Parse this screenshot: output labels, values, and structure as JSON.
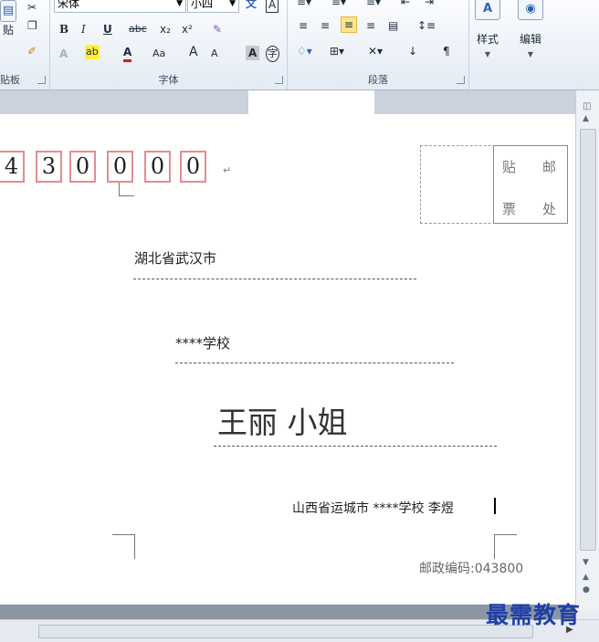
{
  "ribbon": {
    "clipboard": {
      "label": "贴板",
      "paste_label": "贴"
    },
    "font": {
      "label": "字体",
      "font_name": "宋体",
      "font_size": "小四",
      "bold": "B",
      "italic": "I",
      "underline": "U",
      "strike": "abc",
      "subscript": "x₂",
      "superscript": "x²",
      "text_effect": "A",
      "highlight": "ab",
      "font_color": "A",
      "change_case": "Aa",
      "grow_font": "A",
      "shrink_font": "A",
      "char_shading": "A",
      "enclose": "字"
    },
    "paragraph": {
      "label": "段落"
    },
    "styles": {
      "label": "样式"
    },
    "editing": {
      "label": "编辑"
    }
  },
  "document": {
    "postcode_digits": [
      "4",
      "3",
      "0",
      "0",
      "0",
      "0"
    ],
    "stamp": {
      "tl": "贴",
      "tr": "邮",
      "bl": "票",
      "br": "处"
    },
    "recipient_address": "湖北省武汉市",
    "recipient_org": "****学校",
    "recipient_name": "王丽  小姐",
    "sender": "山西省运城市  ****学校  李煜",
    "sender_postcode": "邮政编码:043800",
    "para_mark": "↵"
  },
  "watermark": "最需教育"
}
